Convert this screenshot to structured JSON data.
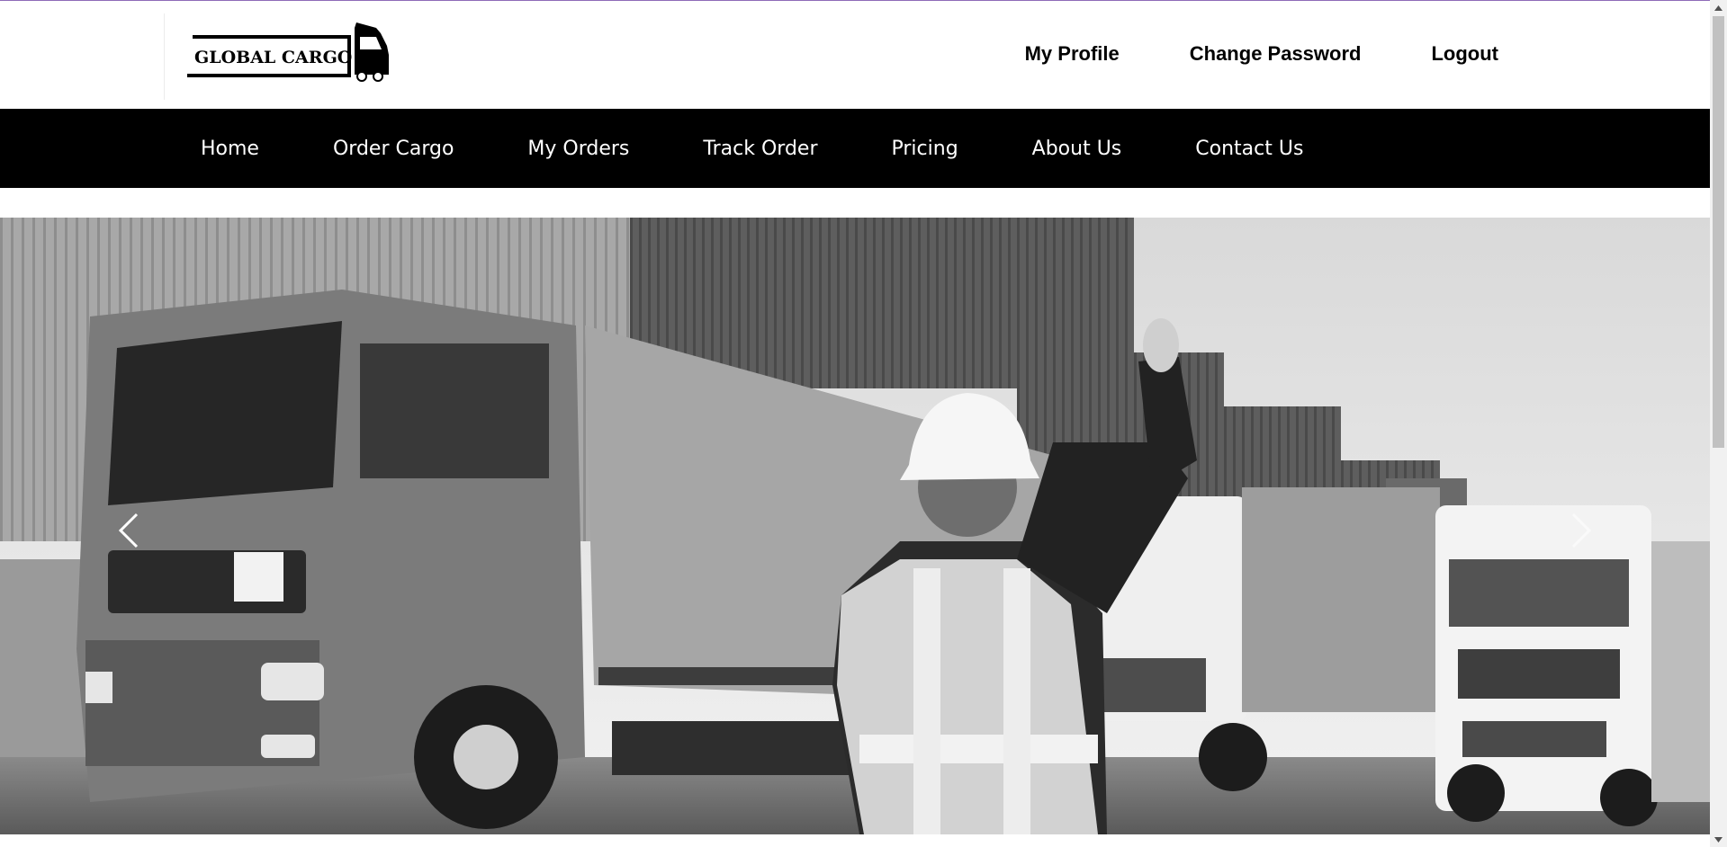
{
  "header": {
    "logo_text": "GLOBAL CARGO",
    "links": [
      {
        "label": "My Profile"
      },
      {
        "label": "Change Password"
      },
      {
        "label": "Logout"
      }
    ]
  },
  "nav": {
    "items": [
      {
        "label": "Home"
      },
      {
        "label": "Order Cargo"
      },
      {
        "label": "My Orders"
      },
      {
        "label": "Track Order"
      },
      {
        "label": "Pricing"
      },
      {
        "label": "About Us"
      },
      {
        "label": "Contact Us"
      }
    ]
  },
  "hero": {
    "image": "grayscale photo of trucks at container port with worker in hard hat and safety vest waving",
    "prev_icon": "chevron-left-icon",
    "next_icon": "chevron-right-icon"
  },
  "colors": {
    "nav_bg": "#000000",
    "nav_text": "#ffffff",
    "header_text": "#000000",
    "top_accent": "#8e6bb8"
  }
}
